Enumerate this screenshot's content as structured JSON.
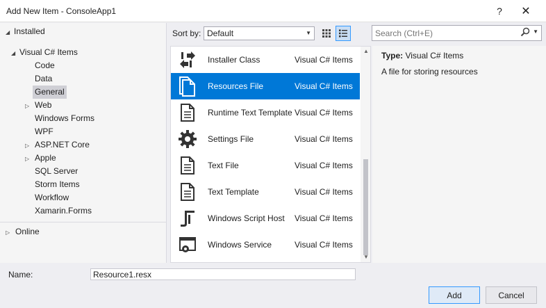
{
  "window": {
    "title": "Add New Item - ConsoleApp1",
    "help": "?",
    "close": "✕"
  },
  "tree": {
    "installed": "Installed",
    "visual_cs": "Visual C# Items",
    "children": [
      "Code",
      "Data",
      "General",
      "Web",
      "Windows Forms",
      "WPF",
      "ASP.NET Core",
      "Apple",
      "SQL Server",
      "Storm Items",
      "Workflow",
      "Xamarin.Forms"
    ],
    "selected": "General",
    "online": "Online"
  },
  "toolbar": {
    "sort_label": "Sort by:",
    "sort_value": "Default"
  },
  "search": {
    "placeholder": "Search (Ctrl+E)"
  },
  "items": [
    {
      "name": "Installer Class",
      "category": "Visual C# Items",
      "icon": "installer-icon"
    },
    {
      "name": "Resources File",
      "category": "Visual C# Items",
      "icon": "resources-file-icon",
      "selected": true
    },
    {
      "name": "Runtime Text Template",
      "category": "Visual C# Items",
      "icon": "text-template-icon"
    },
    {
      "name": "Settings File",
      "category": "Visual C# Items",
      "icon": "gear-icon"
    },
    {
      "name": "Text File",
      "category": "Visual C# Items",
      "icon": "text-file-icon"
    },
    {
      "name": "Text Template",
      "category": "Visual C# Items",
      "icon": "text-template-icon"
    },
    {
      "name": "Windows Script Host",
      "category": "Visual C# Items",
      "icon": "script-icon"
    },
    {
      "name": "Windows Service",
      "category": "Visual C# Items",
      "icon": "service-icon"
    }
  ],
  "details": {
    "type_label": "Type:",
    "type_value": "Visual C# Items",
    "description": "A file for storing resources"
  },
  "footer": {
    "name_label": "Name:",
    "name_value": "Resource1.resx",
    "add": "Add",
    "cancel": "Cancel"
  }
}
